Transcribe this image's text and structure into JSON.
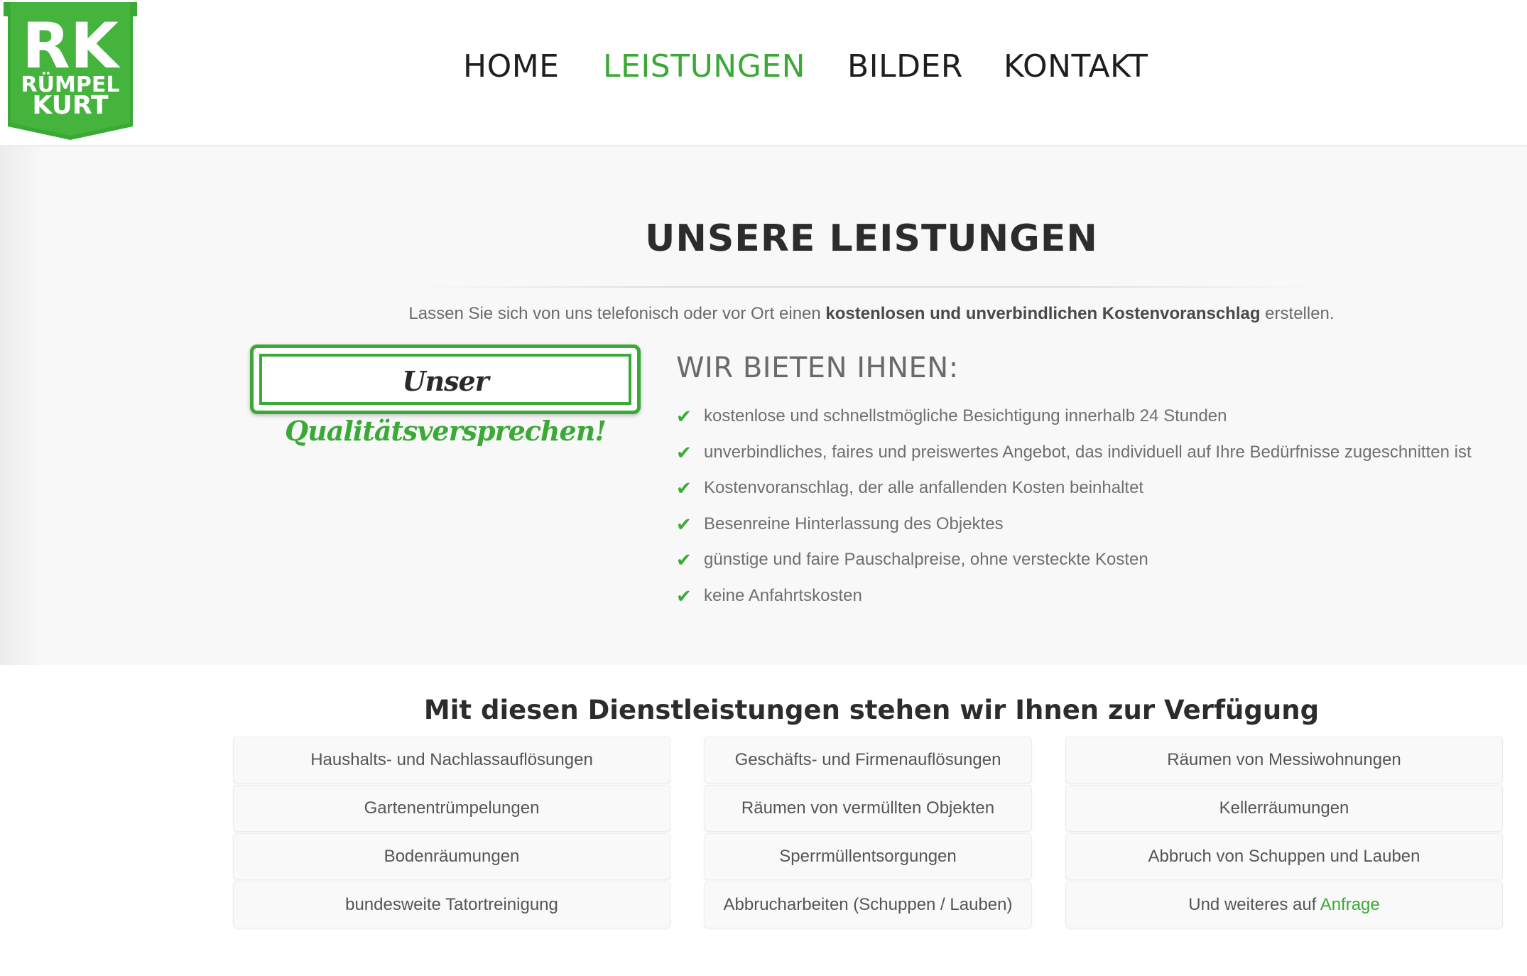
{
  "logo": {
    "initials": "RK",
    "line1": "RÜMPEL",
    "line2": "KURT",
    "brand_color": "#3aa935"
  },
  "nav": {
    "items": [
      {
        "label": "HOME",
        "active": false
      },
      {
        "label": "LEISTUNGEN",
        "active": true
      },
      {
        "label": "BILDER",
        "active": false
      },
      {
        "label": "KONTAKT",
        "active": false
      }
    ]
  },
  "main": {
    "title": "UNSERE LEISTUNGEN",
    "intro_pre": "Lassen Sie sich von uns telefonisch oder vor Ort einen ",
    "intro_bold": "kostenlosen und unverbindlichen Kostenvoranschlag",
    "intro_post": " erstellen.",
    "badge_word1": "Unser",
    "badge_word2": "Qualitätsversprechen!",
    "offer_heading": "WIR BIETEN IHNEN:",
    "check_icon": "check-icon",
    "offers": [
      "kostenlose und schnellstmögliche Besichtigung innerhalb 24 Stunden",
      "unverbindliches, faires und preiswertes Angebot, das individuell auf Ihre Bedürfnisse zugeschnitten ist",
      "Kostenvoranschlag, der alle anfallenden Kosten beinhaltet",
      "Besenreine Hinterlassung des Objektes",
      "günstige und faire Pauschalpreise, ohne versteckte Kosten",
      "keine Anfahrtskosten"
    ]
  },
  "services": {
    "heading": "Mit diesen Dienstleistungen stehen wir Ihnen zur Verfügung",
    "col1": [
      "Haushalts- und Nachlassauflösungen",
      "Gartenentrümpelungen",
      "Bodenräumungen",
      "bundesweite Tatortreinigung"
    ],
    "col2": [
      "Geschäfts- und Firmenauflösungen",
      "Räumen von vermüllten Objekten",
      "Sperrmüllentsorgungen",
      "Abbrucharbeiten (Schuppen / Lauben)"
    ],
    "col3": [
      "Räumen von Messiwohnungen",
      "Kellerräumungen",
      "Abbruch von Schuppen und Lauben"
    ],
    "more_pre": "Und weiteres auf ",
    "more_link": "Anfrage"
  }
}
